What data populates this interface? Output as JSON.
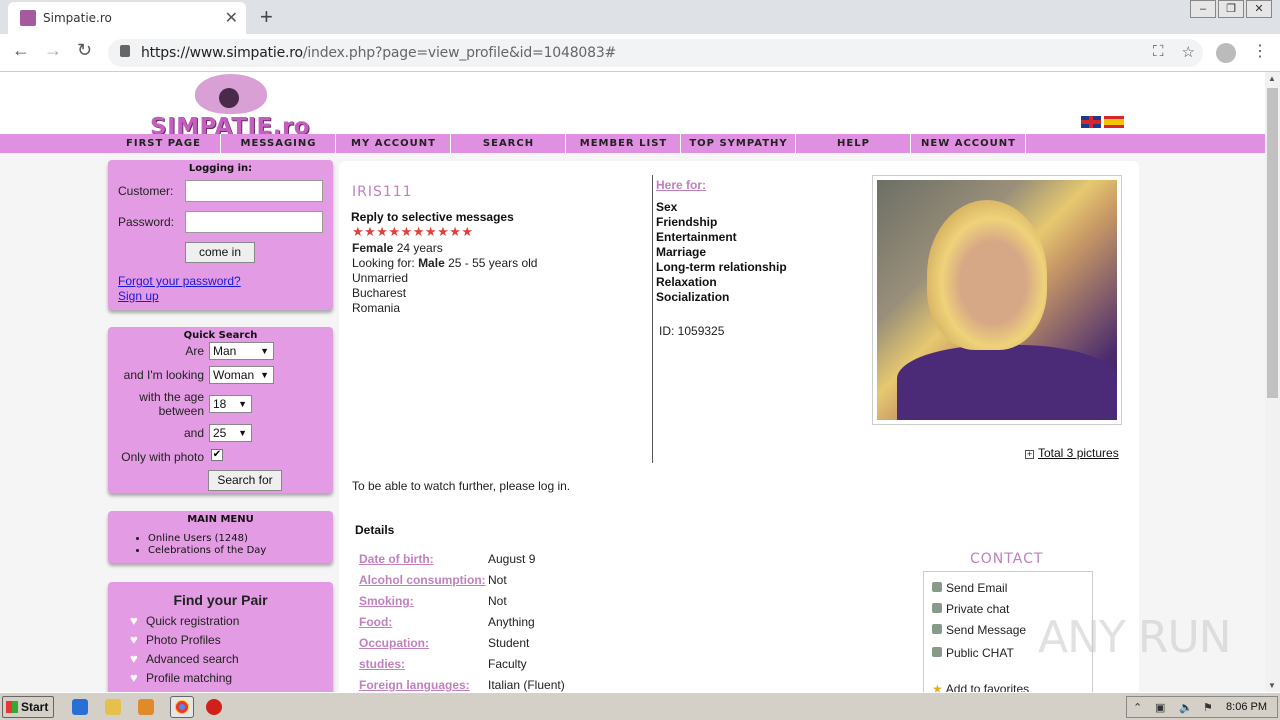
{
  "browser": {
    "tab_title": "Simpatie.ro",
    "url_host": "https://www.simpatie.ro",
    "url_path": "/index.php?page=view_profile&id=1048083#"
  },
  "site": {
    "logo": "SIMPATIE.ro",
    "nav": [
      "FIRST PAGE",
      "MESSAGING",
      "MY ACCOUNT",
      "SEARCH",
      "MEMBER LIST",
      "TOP SYMPATHY",
      "HELP",
      "NEW ACCOUNT"
    ]
  },
  "login": {
    "title": "Logging in:",
    "customer_label": "Customer:",
    "password_label": "Password:",
    "button": "come in",
    "forgot": "Forgot your password?",
    "signup": "Sign up"
  },
  "quick_search": {
    "title": "Quick Search",
    "are_label": "Are",
    "are_value": "Man",
    "looking_label": "and I'm looking",
    "looking_value": "Woman",
    "age_label_1": "with the age",
    "age_label_2": "between",
    "age_from": "18",
    "and_label": "and",
    "age_to": "25",
    "photo_label": "Only with photo",
    "photo_checked": "✔",
    "button": "Search for"
  },
  "main_menu": {
    "title": "MAIN MENU",
    "items": [
      "Online Users (1248)",
      "Celebrations of the Day"
    ]
  },
  "find_pair": {
    "title": "Find your Pair",
    "items": [
      "Quick registration",
      "Photo Profiles",
      "Advanced search",
      "Profile matching"
    ]
  },
  "profile": {
    "name": "IRIS111",
    "reply": "Reply to selective messages",
    "stars": "★★★★★★★★★★",
    "gender": "Female",
    "age": "24 years",
    "looking_prefix": "Looking for:",
    "looking_gender": "Male",
    "looking_range": "25 - 55 years old",
    "status": "Unmarried",
    "city": "Bucharest",
    "country": "Romania",
    "here_for_label": "Here for:",
    "here_for": [
      "Sex",
      "Friendship",
      "Entertainment",
      "Marriage",
      "Long-term relationship",
      "Relaxation",
      "Socialization"
    ],
    "id_text": "ID: 1059325",
    "total_pictures": "Total 3 pictures",
    "login_note": "To be able to watch further, please log in."
  },
  "details": {
    "title": "Details",
    "rows": [
      {
        "label": "Date of birth:",
        "value": "August 9"
      },
      {
        "label": "Alcohol consumption:",
        "value": "Not"
      },
      {
        "label": "Smoking:",
        "value": "Not"
      },
      {
        "label": "Food:",
        "value": "Anything"
      },
      {
        "label": "Occupation:",
        "value": "Student"
      },
      {
        "label": "studies:",
        "value": "Faculty"
      },
      {
        "label": "Foreign languages:",
        "value": "Italian (Fluent)"
      }
    ]
  },
  "contact": {
    "title": "CONTACT",
    "items": [
      "Send Email",
      "Private chat",
      "Send Message",
      "Public CHAT",
      "Add to favorites"
    ]
  },
  "watermark": "ANY RUN",
  "taskbar": {
    "start": "Start",
    "clock": "8:06 PM"
  }
}
